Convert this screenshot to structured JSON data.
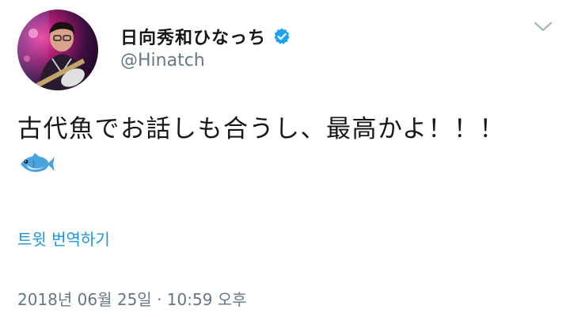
{
  "author": {
    "display_name": "日向秀和ひなっち",
    "handle": "@Hinatch",
    "verified": true
  },
  "tweet": {
    "text": "古代魚でお話しも合うし、最高かよ！！！",
    "emoji": "fish-icon"
  },
  "actions": {
    "translate_label": "트윗 번역하기"
  },
  "meta": {
    "timestamp": "2018년 06월 25일 · 10:59 오후"
  },
  "colors": {
    "link": "#1b95e0",
    "verified": "#1da1f2",
    "text": "#14171a",
    "muted": "#657786"
  }
}
